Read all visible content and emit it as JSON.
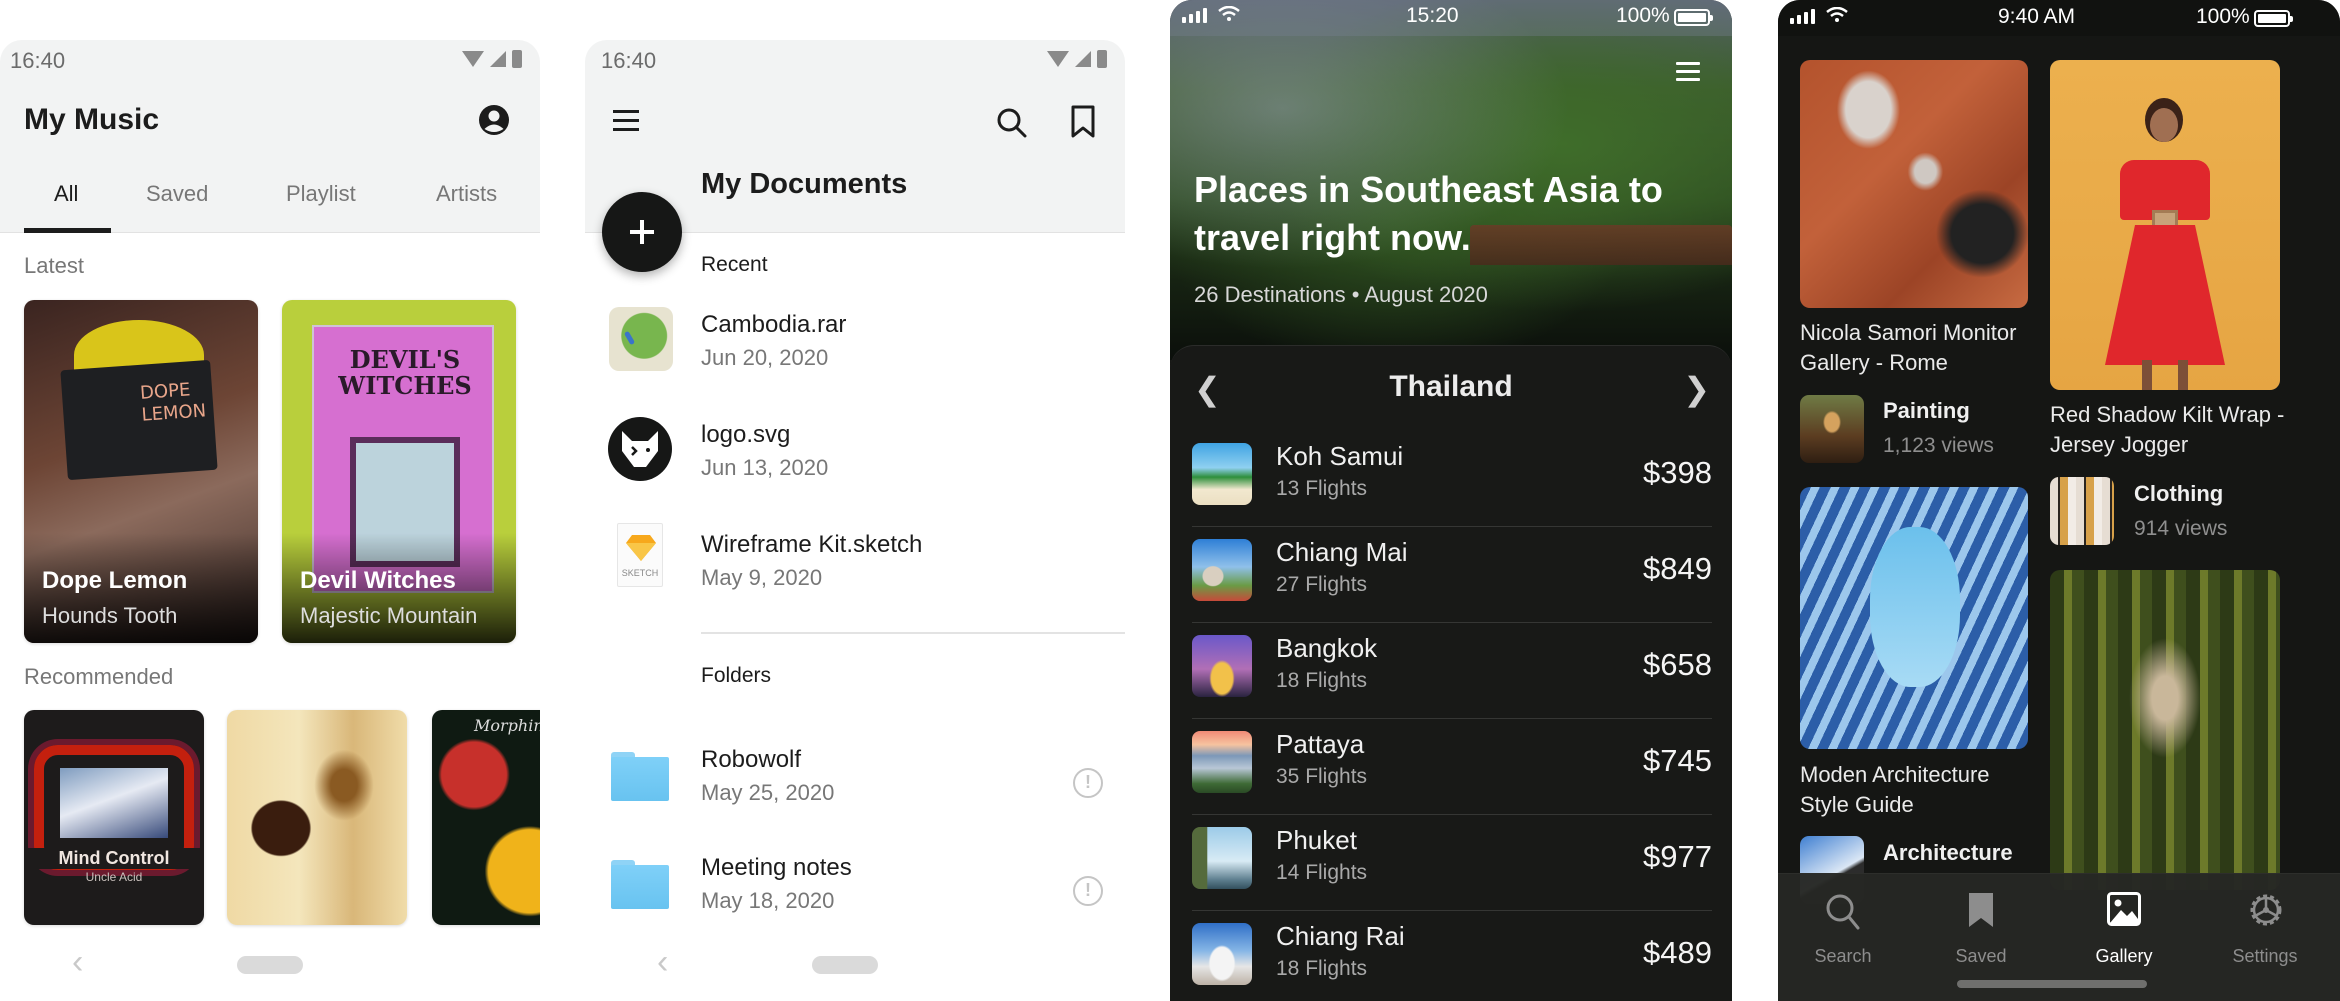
{
  "music_app": {
    "status_time": "16:40",
    "title": "My Music",
    "profile_icon": "account-circle-icon",
    "tabs": [
      {
        "label": "All",
        "active": true
      },
      {
        "label": "Saved",
        "active": false
      },
      {
        "label": "Playlist",
        "active": false
      },
      {
        "label": "Artists",
        "active": false
      }
    ],
    "latest_label": "Latest",
    "latest": [
      {
        "title": "Dope Lemon",
        "subtitle": "Hounds Tooth",
        "cover_text": "DOPE LEMON"
      },
      {
        "title": "Devil Witches",
        "subtitle": "Majestic Mountain",
        "cover_text": "DEVIL'S WITCHES"
      }
    ],
    "recommended_label": "Recommended",
    "recommended": [
      {
        "cover_title": "Mind Control",
        "cover_artist": "Uncle Acid"
      },
      {
        "cover_title": "",
        "cover_artist": ""
      },
      {
        "cover_title": "Morphine",
        "cover_artist": ""
      }
    ],
    "nav": {
      "back_icon": "chevron-left-icon",
      "home_icon": "home-pill-icon"
    }
  },
  "documents_app": {
    "status_time": "16:40",
    "title": "My Documents",
    "menu_icon": "hamburger-menu-icon",
    "search_icon": "search-icon",
    "bookmark_icon": "bookmark-icon",
    "fab_icon": "plus-icon",
    "recent_label": "Recent",
    "recent": [
      {
        "name": "Cambodia.rar",
        "date": "Jun 20, 2020",
        "icon": "map-thumbnail"
      },
      {
        "name": "logo.svg",
        "date": "Jun 13, 2020",
        "icon": "wolf-logo-icon"
      },
      {
        "name": "Wireframe Kit.sketch",
        "date": "May 9, 2020",
        "icon": "sketch-file-icon",
        "icon_label": "SKETCH"
      }
    ],
    "folders_label": "Folders",
    "folders": [
      {
        "name": "Robowolf",
        "date": "May 25, 2020"
      },
      {
        "name": "Meeting notes",
        "date": "May 18, 2020"
      }
    ]
  },
  "travel_app": {
    "status_time": "15:20",
    "battery": "100%",
    "hero_title": "Places in Southeast Asia to travel right now.",
    "hero_subtitle": "26 Destinations • August 2020",
    "country": "Thailand",
    "destinations": [
      {
        "name": "Koh Samui",
        "flights": "13 Flights",
        "price": "$398"
      },
      {
        "name": "Chiang Mai",
        "flights": "27 Flights",
        "price": "$849"
      },
      {
        "name": "Bangkok",
        "flights": "18 Flights",
        "price": "$658"
      },
      {
        "name": "Pattaya",
        "flights": "35 Flights",
        "price": "$745"
      },
      {
        "name": "Phuket",
        "flights": "14 Flights",
        "price": "$977"
      },
      {
        "name": "Chiang Rai",
        "flights": "18 Flights",
        "price": "$489"
      }
    ]
  },
  "gallery_app": {
    "status_time": "9:40 AM",
    "battery": "100%",
    "items": [
      {
        "caption": "Nicola Samori Monitor Gallery - Rome",
        "category": "Painting",
        "views": "1,123 views"
      },
      {
        "caption": "Red Shadow Kilt Wrap - Jersey Jogger",
        "category": "Clothing",
        "views": "914 views"
      },
      {
        "caption": "Moden Architecture Style Guide",
        "category": "Architecture",
        "views": ""
      }
    ],
    "tabbar": [
      {
        "label": "Search",
        "icon": "search-icon",
        "active": false
      },
      {
        "label": "Saved",
        "icon": "bookmark-icon",
        "active": false
      },
      {
        "label": "Gallery",
        "icon": "image-icon",
        "active": true
      },
      {
        "label": "Settings",
        "icon": "gear-icon",
        "active": false
      }
    ]
  }
}
